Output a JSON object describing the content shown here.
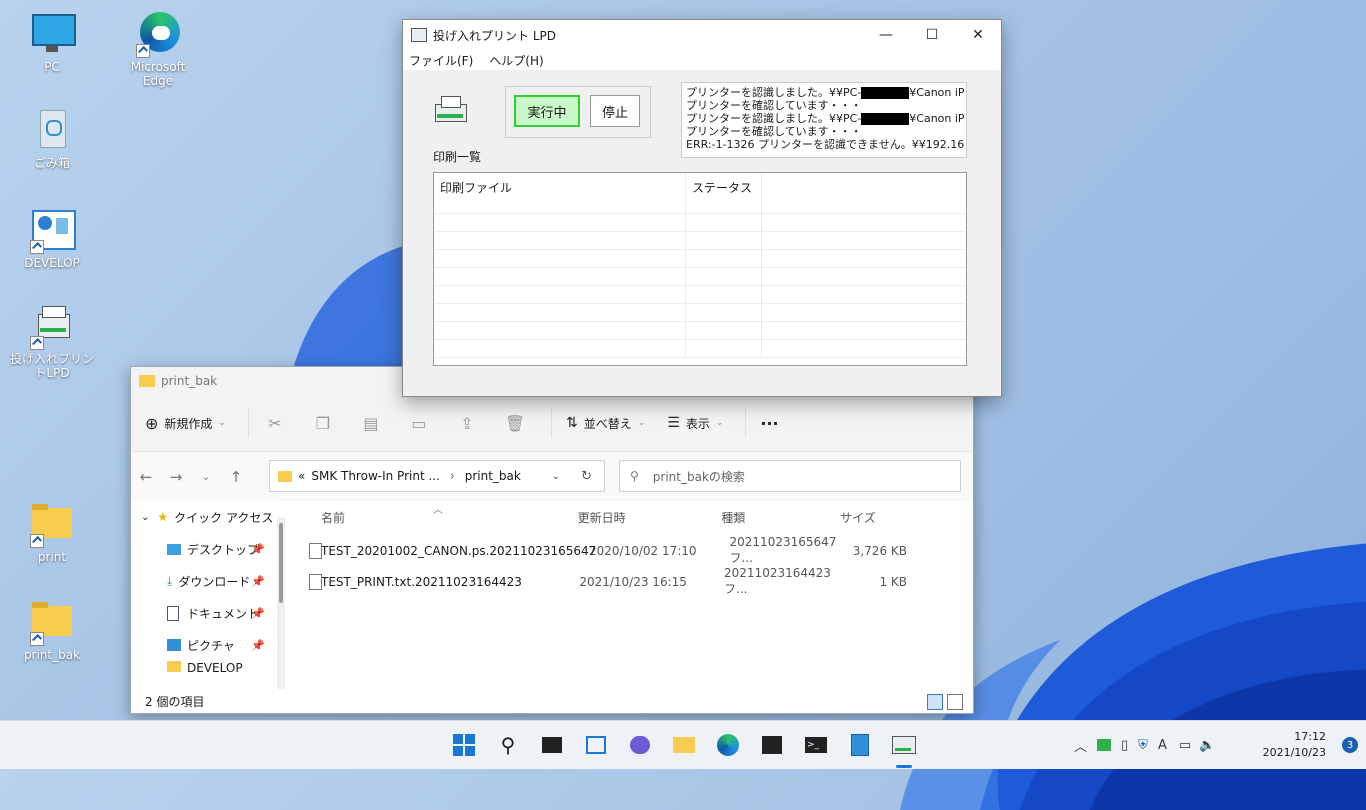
{
  "desktop": {
    "icons": [
      {
        "label": "PC"
      },
      {
        "label": "Microsoft Edge"
      },
      {
        "label": "ごみ箱"
      },
      {
        "label": "DEVELOP"
      },
      {
        "label": "投げ入れプリントLPD"
      },
      {
        "label": "print"
      },
      {
        "label": "print_bak"
      }
    ]
  },
  "lpd": {
    "title": "投げ入れプリント LPD",
    "menu": {
      "file": "ファイル(F)",
      "help": "ヘルプ(H)"
    },
    "run_label": "実行中",
    "stop_label": "停止",
    "log": [
      {
        "pre": "プリンターを認識しました。¥¥PC-",
        "post": "¥Canon iP"
      },
      {
        "pre": "プリンターを確認しています・・・",
        "post": ""
      },
      {
        "pre": "プリンターを認識しました。¥¥PC-",
        "post": "¥Canon iP"
      },
      {
        "pre": "プリンターを確認しています・・・",
        "post": ""
      },
      {
        "pre": "ERR:-1-1326 プリンターを認識できません。¥¥192.16",
        "post": ""
      }
    ],
    "print_list_label": "印刷一覧",
    "columns": {
      "file": "印刷ファイル",
      "status": "ステータス"
    }
  },
  "explorer": {
    "title": "print_bak",
    "toolbar": {
      "new": "新規作成",
      "sort": "並べ替え",
      "view": "表示"
    },
    "address": {
      "prefix": "«",
      "segment1": "SMK Throw-In Print ...",
      "segment2": "print_bak"
    },
    "search_placeholder": "print_bakの検索",
    "nav": {
      "quick_access": "クイック アクセス",
      "items": [
        "デスクトップ",
        "ダウンロード",
        "ドキュメント",
        "ピクチャ",
        "DEVELOP"
      ]
    },
    "columns": {
      "name": "名前",
      "date": "更新日時",
      "type": "種類",
      "size": "サイズ"
    },
    "files": [
      {
        "name": "TEST_20201002_CANON.ps.20211023165647",
        "date": "2020/10/02 17:10",
        "type": "20211023165647 フ...",
        "size": "3,726 KB"
      },
      {
        "name": "TEST_PRINT.txt.20211023164423",
        "date": "2021/10/23 16:15",
        "type": "20211023164423 フ...",
        "size": "1 KB"
      }
    ],
    "status": "2 個の項目"
  },
  "taskbar": {
    "time": "17:12",
    "date": "2021/10/23",
    "notifications": "3",
    "ime": "A"
  },
  "colors": {
    "accent": "#1a5fb4",
    "run_green": "#2fcf2f",
    "run_fill": "#c8f7c8"
  }
}
